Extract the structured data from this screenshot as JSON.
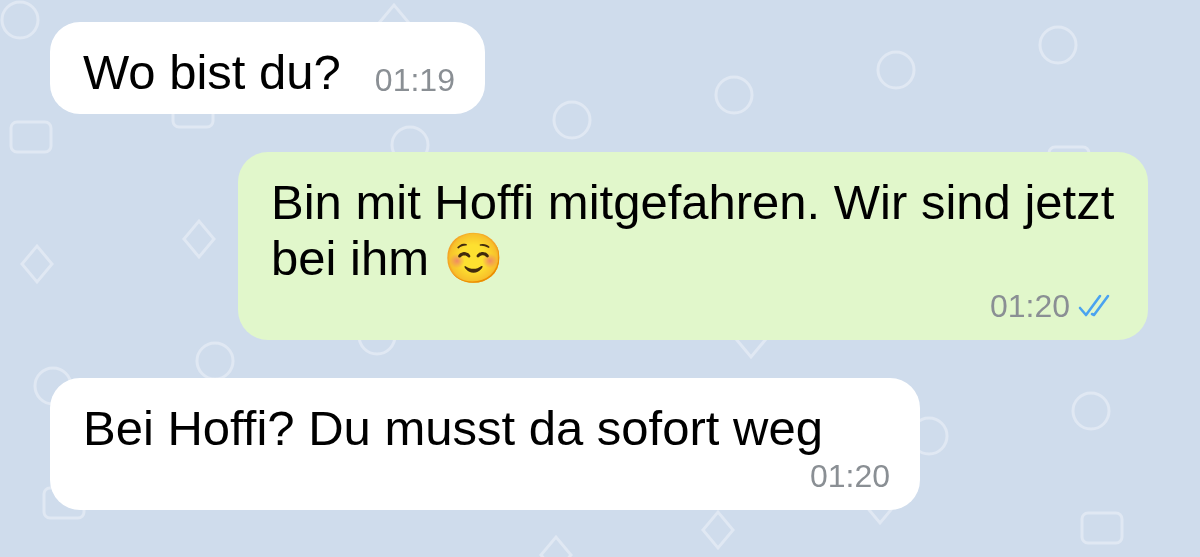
{
  "messages": [
    {
      "kind": "incoming",
      "text": "Wo bist du?",
      "time": "01:19"
    },
    {
      "kind": "outgoing",
      "text": "Bin mit Hoffi mitgefahren. Wir sind jetzt bei ihm ☺️",
      "time": "01:20",
      "read": true
    },
    {
      "kind": "incoming",
      "text": "Bei Hoffi? Du musst da sofort weg",
      "time": "01:20"
    }
  ]
}
